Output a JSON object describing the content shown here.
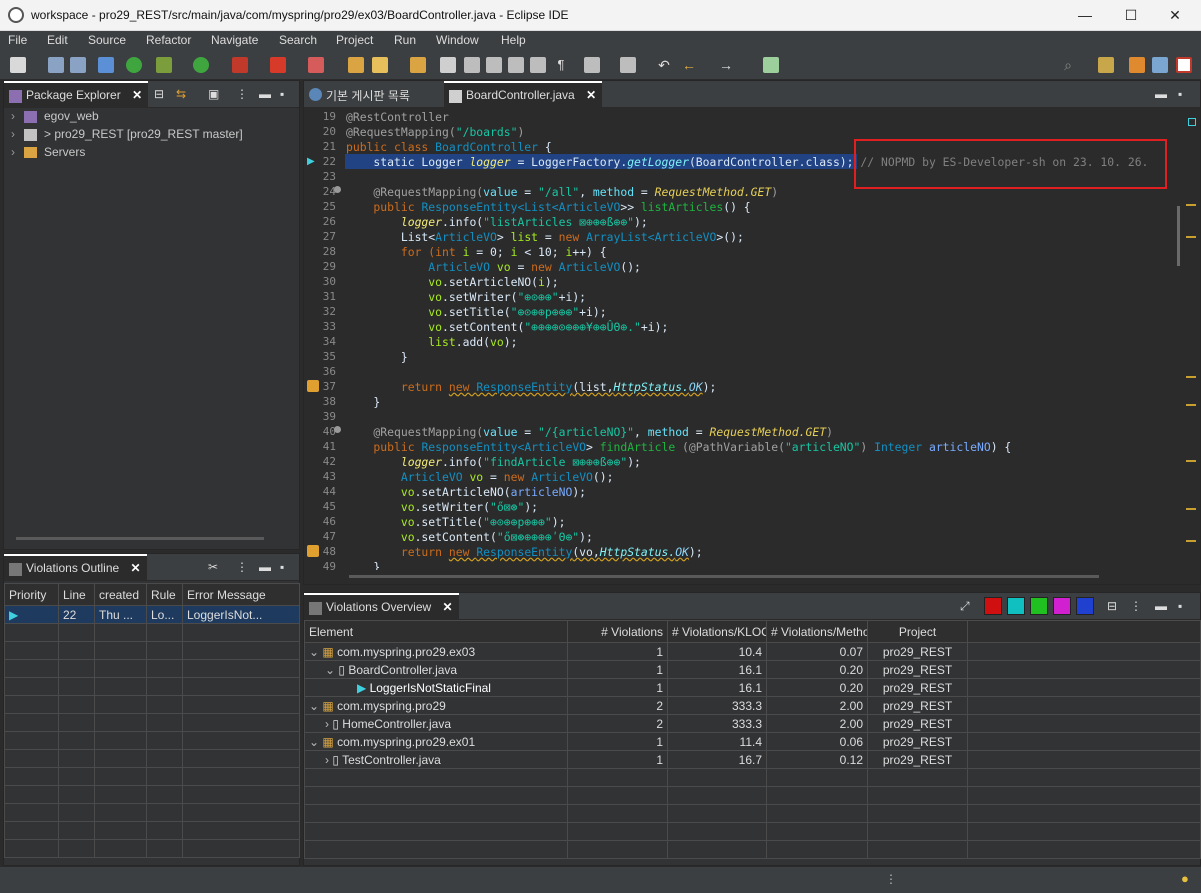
{
  "window": {
    "title": "workspace - pro29_REST/src/main/java/com/myspring/pro29/ex03/BoardController.java - Eclipse IDE",
    "minimize": "—",
    "maximize": "☐",
    "close": "✕"
  },
  "menu": [
    "File",
    "Edit",
    "Source",
    "Refactor",
    "Navigate",
    "Search",
    "Project",
    "Run",
    "Window",
    "Help"
  ],
  "package_explorer": {
    "tab": "Package Explorer",
    "items": [
      {
        "label": "egov_web"
      },
      {
        "label": "> pro29_REST [pro29_REST master]"
      },
      {
        "label": "Servers"
      }
    ]
  },
  "violations_outline": {
    "tab": "Violations Outline",
    "columns": [
      "Priority",
      "Line",
      "created",
      "Rule",
      "Error Message"
    ],
    "rows": [
      [
        "",
        "22",
        "Thu ...",
        "Lo...",
        "LoggerIsNot..."
      ]
    ]
  },
  "editor": {
    "tabs": [
      "기본 게시판 목록",
      "BoardController.java"
    ],
    "lines": [
      {
        "n": "19"
      },
      {
        "n": "20"
      },
      {
        "n": "21"
      },
      {
        "n": "22"
      },
      {
        "n": "23"
      },
      {
        "n": "24"
      },
      {
        "n": "25"
      },
      {
        "n": "26"
      },
      {
        "n": "27"
      },
      {
        "n": "28"
      },
      {
        "n": "29"
      },
      {
        "n": "30"
      },
      {
        "n": "31"
      },
      {
        "n": "32"
      },
      {
        "n": "33"
      },
      {
        "n": "34"
      },
      {
        "n": "35"
      },
      {
        "n": "36"
      },
      {
        "n": "37"
      },
      {
        "n": "38"
      },
      {
        "n": "39"
      },
      {
        "n": "40"
      },
      {
        "n": "41"
      },
      {
        "n": "42"
      },
      {
        "n": "43"
      },
      {
        "n": "44"
      },
      {
        "n": "45"
      },
      {
        "n": "46"
      },
      {
        "n": "47"
      },
      {
        "n": "48"
      },
      {
        "n": "49"
      }
    ],
    "code": {
      "l19": "@RestController",
      "l20a": "@RequestMapping(",
      "l20b": "\"/boards\"",
      "l20c": ")",
      "l21a": "public class ",
      "l21b": "BoardController",
      "l21c": " {",
      "l22a": "    static Logger ",
      "l22b": "logger",
      "l22c": " = LoggerFactory.",
      "l22d": "getLogger",
      "l22e": "(BoardController.class);",
      "l22comment": " // NOPMD by ES-Developer-sh on 23. 10. 26.",
      "l24a": "    @RequestMapping(",
      "l24b": "value",
      "l24c": " = ",
      "l24d": "\"/all\"",
      "l24e": ", ",
      "l24f": "method",
      "l24g": " = ",
      "l24h": "RequestMethod.GET",
      "l24i": ")",
      "l25a": "    public ",
      "l25b": "ResponseEntity",
      "l25c": "<List<",
      "l25d": "ArticleVO",
      "l25e": ">> ",
      "l25f": "listArticles",
      "l25g": "() {",
      "l26a": "        logger",
      "l26b": ".info(",
      "l26c": "\"listArticles ⊠⊕⊕⊕ß⊕⊕\"",
      "l26d": ");",
      "l27a": "        List<",
      "l27b": "ArticleVO",
      "l27c": "> ",
      "l27d": "list",
      "l27e": " = ",
      "l27f": "new ",
      "l27g": "ArrayList<",
      "l27h": "ArticleVO",
      "l27i": ">();",
      "l28a": "        for (",
      "l28b": "int ",
      "l28c": "i",
      "l28d": " = 0; ",
      "l28e": "i",
      "l28f": " < 10; ",
      "l28g": "i",
      "l28h": "++) {",
      "l29a": "            ArticleVO ",
      "l29b": "vo",
      "l29c": " = ",
      "l29d": "new ",
      "l29e": "ArticleVO",
      "l29f": "();",
      "l30a": "            vo",
      "l30b": ".setArticleNO(",
      "l30c": "i",
      "l30d": ");",
      "l31a": "            vo",
      "l31b": ".setWriter(",
      "l31c": "\"⊕⊙⊕⊕\"",
      "l31d": "+i);",
      "l32a": "            vo",
      "l32b": ".setTitle(",
      "l32c": "\"⊕⊙⊕⊕p⊕⊕⊕\"",
      "l32d": "+i);",
      "l33a": "            vo",
      "l33b": ".setContent(",
      "l33c": "\"⊕⊕⊕⊕⊙⊕⊕⊕¥⊕⊕ÛΘ⊕.\"",
      "l33d": "+i);",
      "l34a": "            list",
      "l34b": ".add(",
      "l34c": "vo",
      "l34d": ");",
      "l35": "        }",
      "l37a": "        return ",
      "l37b": "new ",
      "l37c": "ResponseEntity",
      "l37d": "(list,",
      "l37e": "HttpStatus.",
      "l37f": "OK",
      "l37g": ");",
      "l38": "    }",
      "l40a": "    @RequestMapping(",
      "l40b": "value",
      "l40c": " = ",
      "l40d": "\"/{articleNO}\"",
      "l40e": ", ",
      "l40f": "method",
      "l40g": " = ",
      "l40h": "RequestMethod.GET",
      "l40i": ")",
      "l41a": "    public ",
      "l41b": "ResponseEntity",
      "l41c": "<",
      "l41d": "ArticleVO",
      "l41e": "> ",
      "l41f": "findArticle",
      "l41g": " (@PathVariable(",
      "l41h": "\"articleNO\"",
      "l41i": ") ",
      "l41j": "Integer ",
      "l41k": "articleNO",
      "l41l": ") {",
      "l42a": "        logger",
      "l42b": ".info(",
      "l42c": "\"findArticle ⊠⊕⊕⊕ß⊕⊕\"",
      "l42d": ");",
      "l43a": "        ArticleVO ",
      "l43b": "vo",
      "l43c": " = ",
      "l43d": "new ",
      "l43e": "ArticleVO",
      "l43f": "();",
      "l44a": "        vo",
      "l44b": ".setArticleNO(",
      "l44c": "articleNO",
      "l44d": ");",
      "l45a": "        vo",
      "l45b": ".setWriter(",
      "l45c": "\"ő⊠⊛\"",
      "l45d": ");",
      "l46a": "        vo",
      "l46b": ".setTitle(",
      "l46c": "\"⊕⊙⊕⊕p⊕⊕⊕\"",
      "l46d": ");",
      "l47a": "        vo",
      "l47b": ".setContent(",
      "l47c": "\"ő⊠⊛⊕⊕⊕⊕ʹΘ⊕\"",
      "l47d": ");",
      "l48a": "        return ",
      "l48b": "new ",
      "l48c": "ResponseEntity",
      "l48d": "(vo,",
      "l48e": "HttpStatus.",
      "l48f": "OK",
      "l48g": ");",
      "l49": "    }"
    }
  },
  "violations_overview": {
    "tab": "Violations Overview",
    "columns": [
      "Element",
      "# Violations",
      "# Violations/KLOC",
      "# Violations/Method",
      "Project"
    ],
    "rows": [
      {
        "element": "com.myspring.pro29.ex03",
        "v": "1",
        "kloc": "10.4",
        "method": "0.07",
        "project": "pro29_REST"
      },
      {
        "element": "BoardController.java",
        "v": "1",
        "kloc": "16.1",
        "method": "0.20",
        "project": "pro29_REST"
      },
      {
        "element": "LoggerIsNotStaticFinal",
        "v": "1",
        "kloc": "16.1",
        "method": "0.20",
        "project": "pro29_REST"
      },
      {
        "element": "com.myspring.pro29",
        "v": "2",
        "kloc": "333.3",
        "method": "2.00",
        "project": "pro29_REST"
      },
      {
        "element": "HomeController.java",
        "v": "2",
        "kloc": "333.3",
        "method": "2.00",
        "project": "pro29_REST"
      },
      {
        "element": "com.myspring.pro29.ex01",
        "v": "1",
        "kloc": "11.4",
        "method": "0.06",
        "project": "pro29_REST"
      },
      {
        "element": "TestController.java",
        "v": "1",
        "kloc": "16.7",
        "method": "0.12",
        "project": "pro29_REST"
      }
    ]
  },
  "colors": {
    "highlight_box": "#e02020",
    "selected_line": "#214283",
    "active_tab_border": "#ffffff"
  }
}
